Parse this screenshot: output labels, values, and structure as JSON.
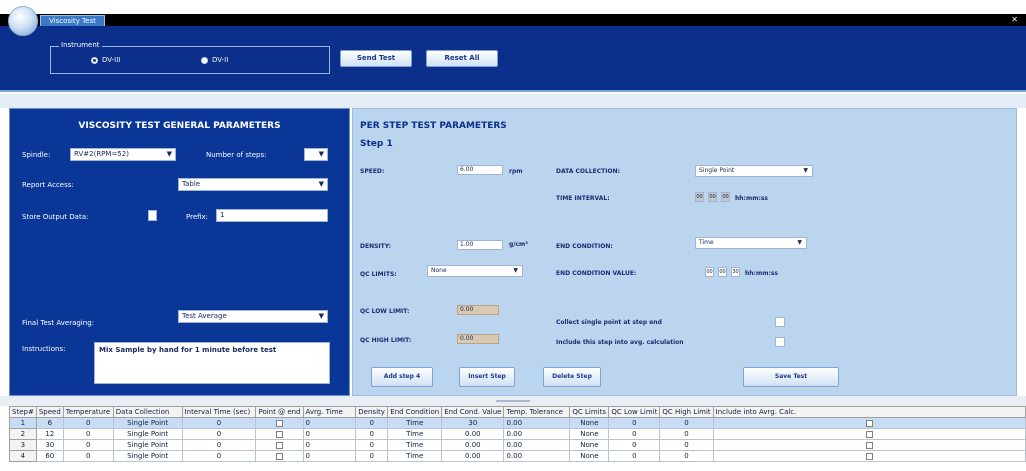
{
  "window": {
    "tab_label": "Viscosity Test",
    "close_glyph": "✕"
  },
  "instrument": {
    "legend": "Instrument",
    "options": [
      {
        "label": "DV-III",
        "selected": true
      },
      {
        "label": "DV-II",
        "selected": false
      }
    ]
  },
  "toolbar": {
    "send_label": "Send Test",
    "reset_label": "Reset All"
  },
  "general": {
    "title": "VISCOSITY TEST GENERAL PARAMETERS",
    "spindle_label": "Spindle:",
    "spindle_value": "RV#2(RPM=52)",
    "num_steps_label": "Number of steps:",
    "report_access_label": "Report Access:",
    "report_access_value": "Table",
    "store_label": "Store Output Data:",
    "prefix_label": "Prefix:",
    "prefix_value": "1",
    "final_avg_label": "Final Test Averaging:",
    "final_avg_value": "Test Average",
    "instructions_label": "Instructions:",
    "instructions_value": "Mix Sample by hand for 1 minute before test"
  },
  "step": {
    "title": "PER STEP TEST PARAMETERS",
    "step_label": "Step 1",
    "speed_label": "SPEED:",
    "speed_value": "6.00",
    "speed_unit": "rpm",
    "data_collection_label": "DATA COLLECTION:",
    "data_collection_value": "Single Point",
    "time_interval_label": "TIME INTERVAL:",
    "time_interval_values": [
      "00",
      "00",
      "00"
    ],
    "time_unit": "hh:mm:ss",
    "density_label": "DENSITY:",
    "density_value": "1.00",
    "density_unit": "g/cm³",
    "end_condition_label": "END CONDITION:",
    "end_condition_value": "Time",
    "qc_limits_label": "QC LIMITS:",
    "qc_limits_value": "None",
    "end_condition_value_label": "END CONDITION VALUE:",
    "end_condition_times": [
      "00",
      "00",
      "30"
    ],
    "end_condition_unit": "hh:mm:ss",
    "qc_low_label": "QC LOW LIMIT:",
    "qc_low_value": "0.00",
    "qc_high_label": "QC HIGH LIMIT:",
    "qc_high_value": "0.00",
    "collect_label": "Collect single point at step end",
    "include_label": "Include this step into avg. calculation",
    "buttons": {
      "add": "Add step 4",
      "insert": "Insert Step",
      "delete": "Delete Step",
      "save": "Save Test"
    }
  },
  "table": {
    "columns": [
      "Step#",
      "Speed",
      "Temperature",
      "Data Collection",
      "Interval Time (sec)",
      "Point @ end",
      "Avrg. Time",
      "Density",
      "End Condition",
      "End Cond. Value",
      "Temp. Tolerance",
      "QC Limits",
      "QC Low Limit",
      "QC High Limit",
      "Include into Avrg. Calc."
    ],
    "rows": [
      [
        "1",
        "6",
        "0",
        "Single Point",
        "0",
        "",
        "0",
        "0",
        "Time",
        "30",
        "0.00",
        "None",
        "0",
        "0",
        ""
      ],
      [
        "2",
        "12",
        "0",
        "Single Point",
        "0",
        "",
        "0",
        "0",
        "Time",
        "0.00",
        "0.00",
        "None",
        "0",
        "0",
        ""
      ],
      [
        "3",
        "30",
        "0",
        "Single Point",
        "0",
        "",
        "0",
        "0",
        "Time",
        "0.00",
        "0.00",
        "None",
        "0",
        "0",
        ""
      ],
      [
        "4",
        "60",
        "0",
        "Single Point",
        "0",
        "",
        "0",
        "0",
        "Time",
        "0.00",
        "0.00",
        "None",
        "0",
        "0",
        ""
      ]
    ]
  }
}
